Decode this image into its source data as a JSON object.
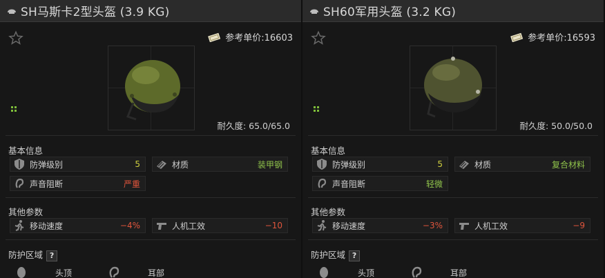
{
  "left": {
    "title": "SH马斯卡2型头盔 (3.9 KG)",
    "price_label": "参考单价:16603",
    "durability": "耐久度: 65.0/65.0",
    "section_basic": "基本信息",
    "armor_class_label": "防弹级别",
    "armor_class_value": "5",
    "material_label": "材质",
    "material_value": "装甲钢",
    "sound_label": "声音阻断",
    "sound_value": "严重",
    "section_other": "其他参数",
    "speed_label": "移动速度",
    "speed_value": "−4%",
    "ergo_label": "人机工效",
    "ergo_value": "−10",
    "section_zone": "防护区域",
    "zone_head": "头顶",
    "zone_ears": "耳部"
  },
  "right": {
    "title": "SH60军用头盔 (3.2 KG)",
    "price_label": "参考单价:16593",
    "durability": "耐久度: 50.0/50.0",
    "section_basic": "基本信息",
    "armor_class_label": "防弹级别",
    "armor_class_value": "5",
    "material_label": "材质",
    "material_value": "复合材料",
    "sound_label": "声音阻断",
    "sound_value": "轻微",
    "section_other": "其他参数",
    "speed_label": "移动速度",
    "speed_value": "−3%",
    "ergo_label": "人机工效",
    "ergo_value": "−9",
    "section_zone": "防护区域",
    "zone_head": "头顶",
    "zone_ears": "耳部"
  },
  "help_glyph": "?",
  "colors": {
    "yellow": "#cfcf3f",
    "green": "#8fc24b",
    "red": "#e0553c"
  }
}
